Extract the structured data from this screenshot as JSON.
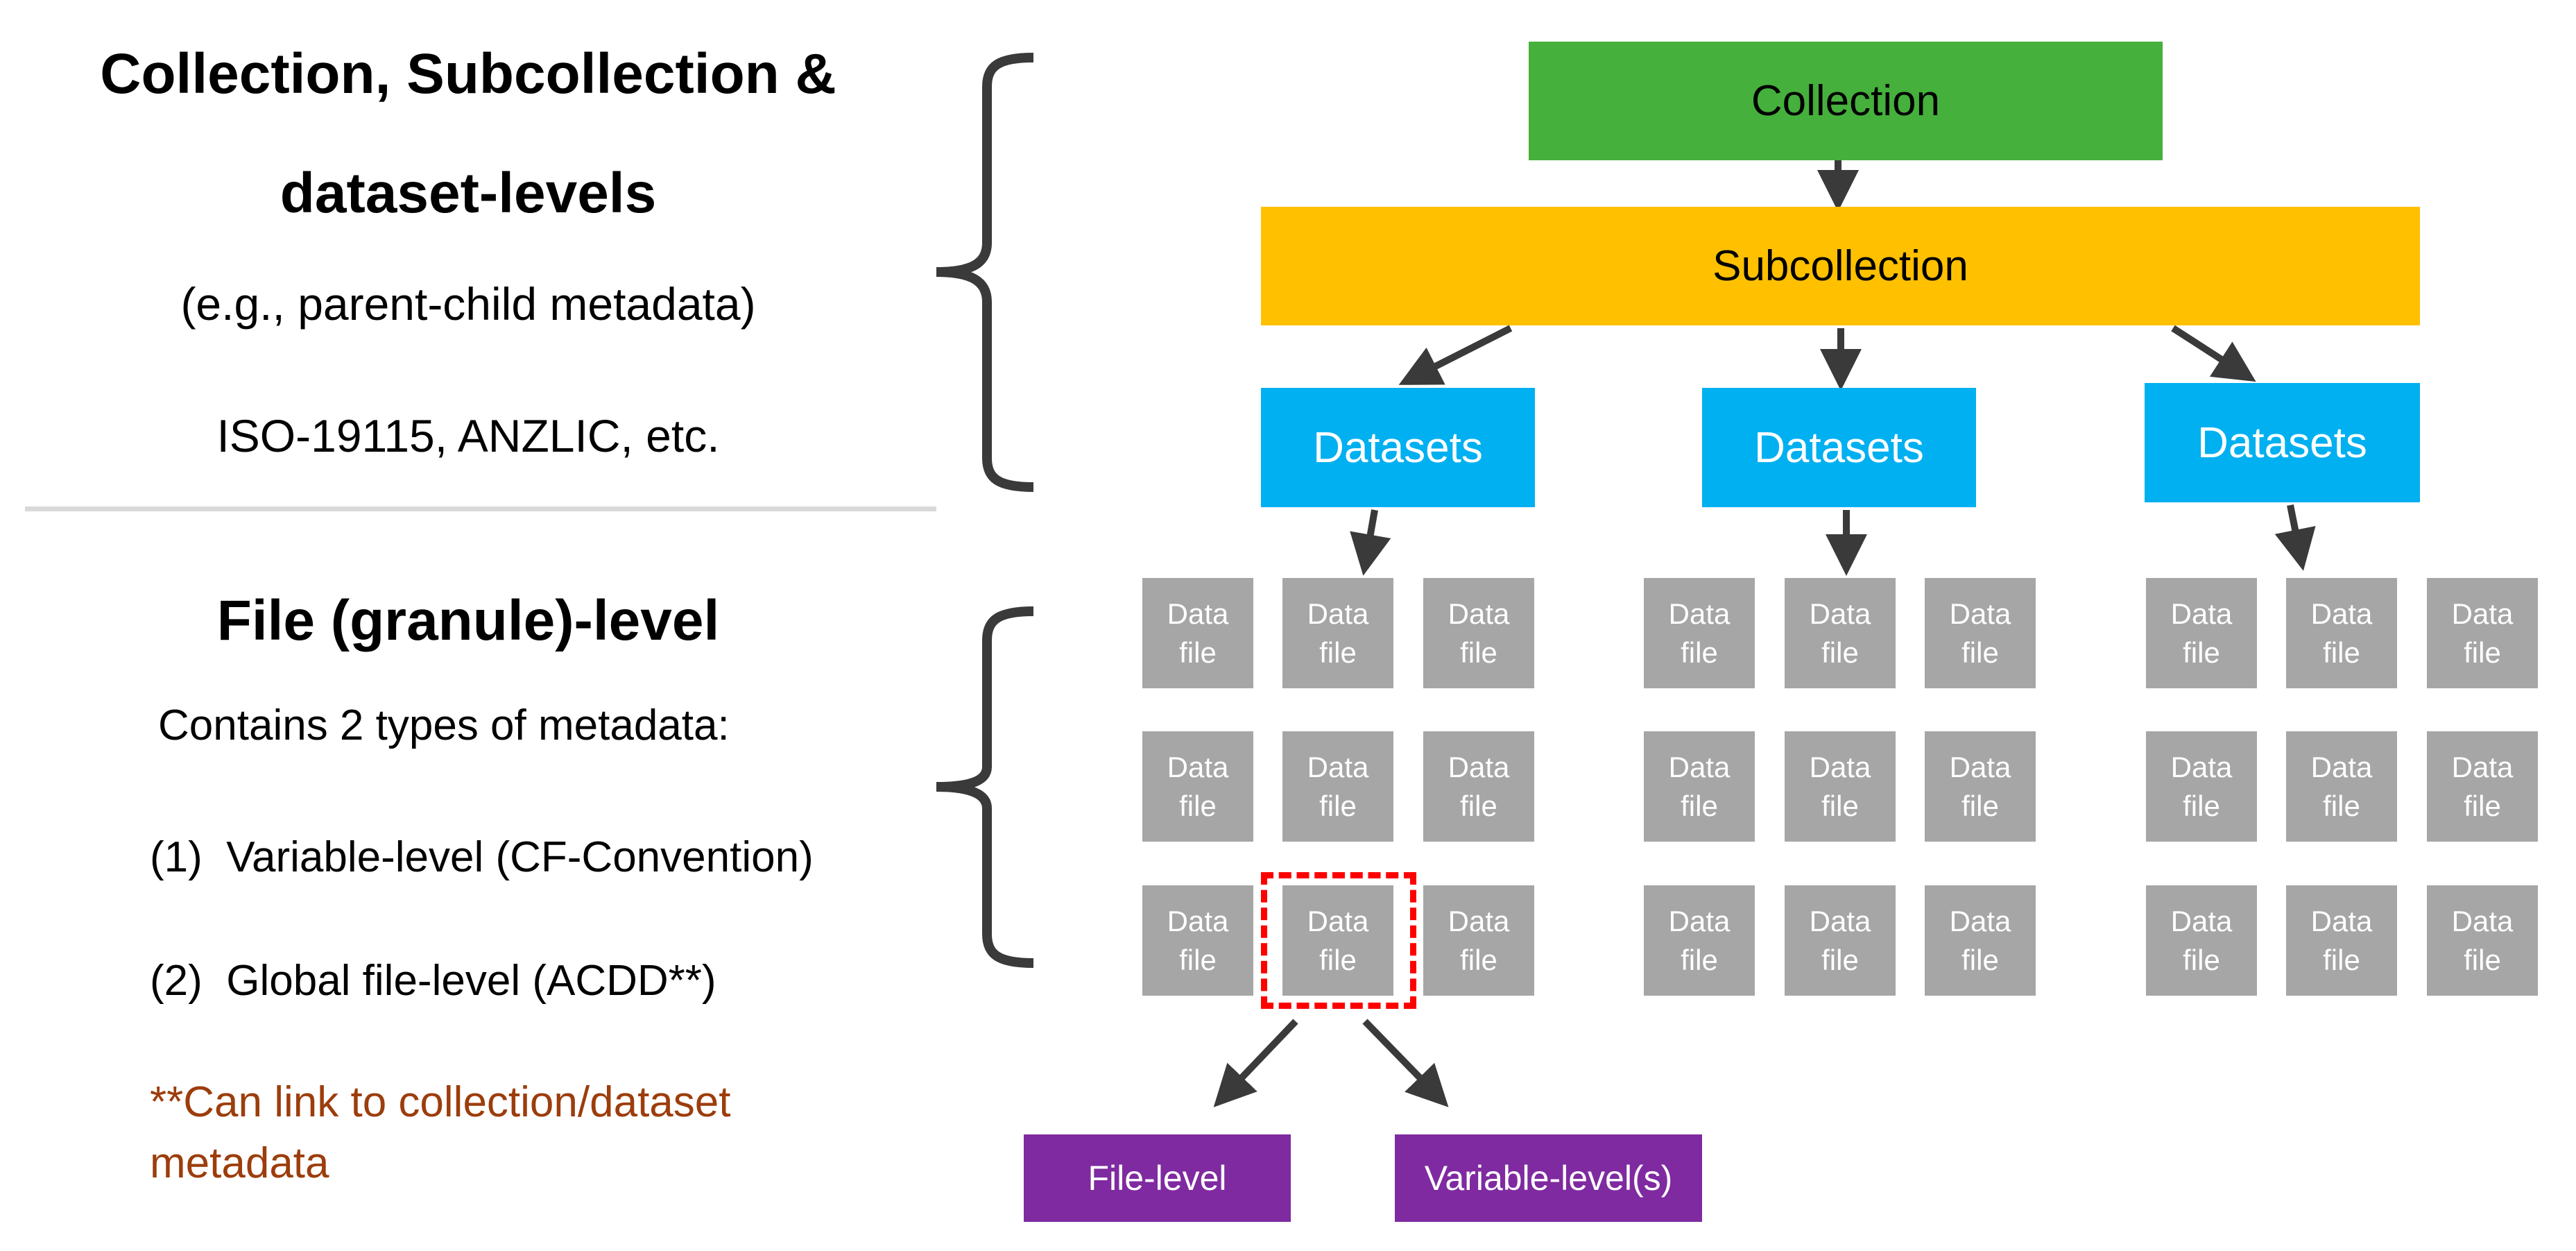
{
  "left_panel": {
    "top_section": {
      "heading_line1": "Collection, Subcollection &",
      "heading_line2": "dataset-levels",
      "example": "(e.g., parent-child metadata)",
      "standards": "ISO-19115, ANZLIC, etc."
    },
    "bottom_section": {
      "heading": "File (granule)-level",
      "intro": "Contains 2 types of metadata:",
      "items": [
        {
          "marker": "(1)",
          "text": "Variable-level (CF-Convention)"
        },
        {
          "marker": "(2)",
          "text": "Global file-level (ACDD**)"
        }
      ],
      "footnote_line1": "**Can link to collection/dataset",
      "footnote_line2": "metadata"
    }
  },
  "hierarchy": {
    "collection": "Collection",
    "subcollection": "Subcollection",
    "datasets": [
      "Datasets",
      "Datasets",
      "Datasets"
    ],
    "data_file_label": {
      "line1": "Data",
      "line2": "file"
    },
    "grid": {
      "groups": 3,
      "rows": 3,
      "cols": 3
    },
    "highlighted_file": {
      "group": 0,
      "row": 2,
      "col": 1
    },
    "outputs": {
      "file_level": "File-level",
      "variable_level": "Variable-level(s)"
    }
  },
  "colors": {
    "collection": "#45b03c",
    "subcollection": "#ffc000",
    "datasets": "#00b0f0",
    "data_file": "#a6a6a6",
    "metadata_output": "#7f2aa0",
    "highlight": "#ff0000",
    "footnote": "#9c3d0c",
    "arrow": "#3a3a3a"
  }
}
